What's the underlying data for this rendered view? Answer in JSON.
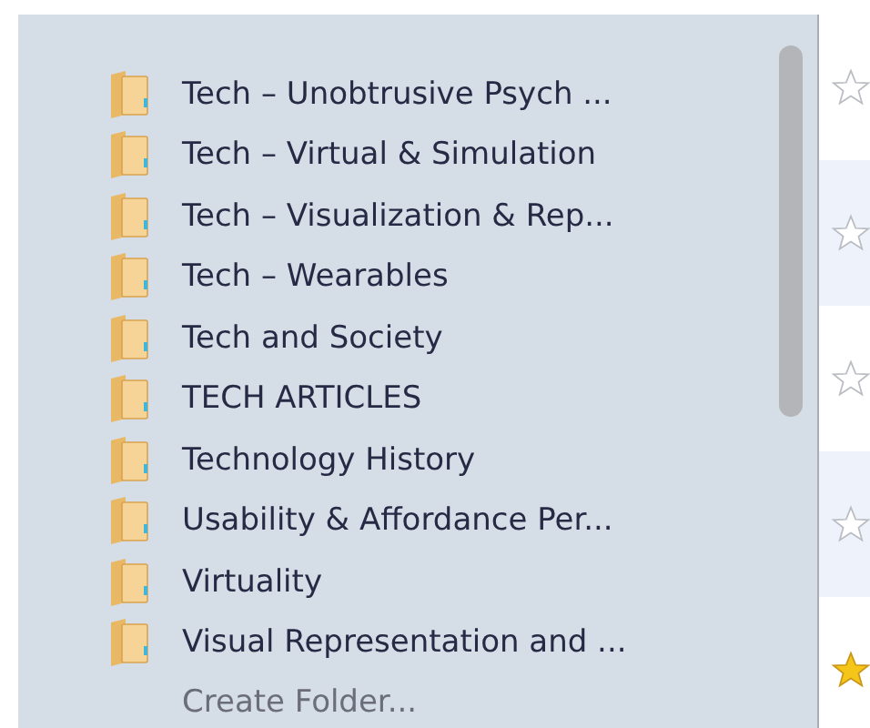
{
  "folders": [
    {
      "label": "Tech – Unobtrusive Psych ..."
    },
    {
      "label": "Tech – Virtual & Simulation"
    },
    {
      "label": "Tech – Visualization & Rep..."
    },
    {
      "label": "Tech – Wearables"
    },
    {
      "label": "Tech and Society"
    },
    {
      "label": "TECH ARTICLES"
    },
    {
      "label": "Technology History"
    },
    {
      "label": "Usability & Affordance Per..."
    },
    {
      "label": "Virtuality"
    },
    {
      "label": "Visual Representation and ..."
    }
  ],
  "create_folder": "Create Folder...",
  "rows": [
    {
      "starred": false
    },
    {
      "starred": false
    },
    {
      "starred": false
    },
    {
      "starred": false
    },
    {
      "starred": true
    }
  ]
}
